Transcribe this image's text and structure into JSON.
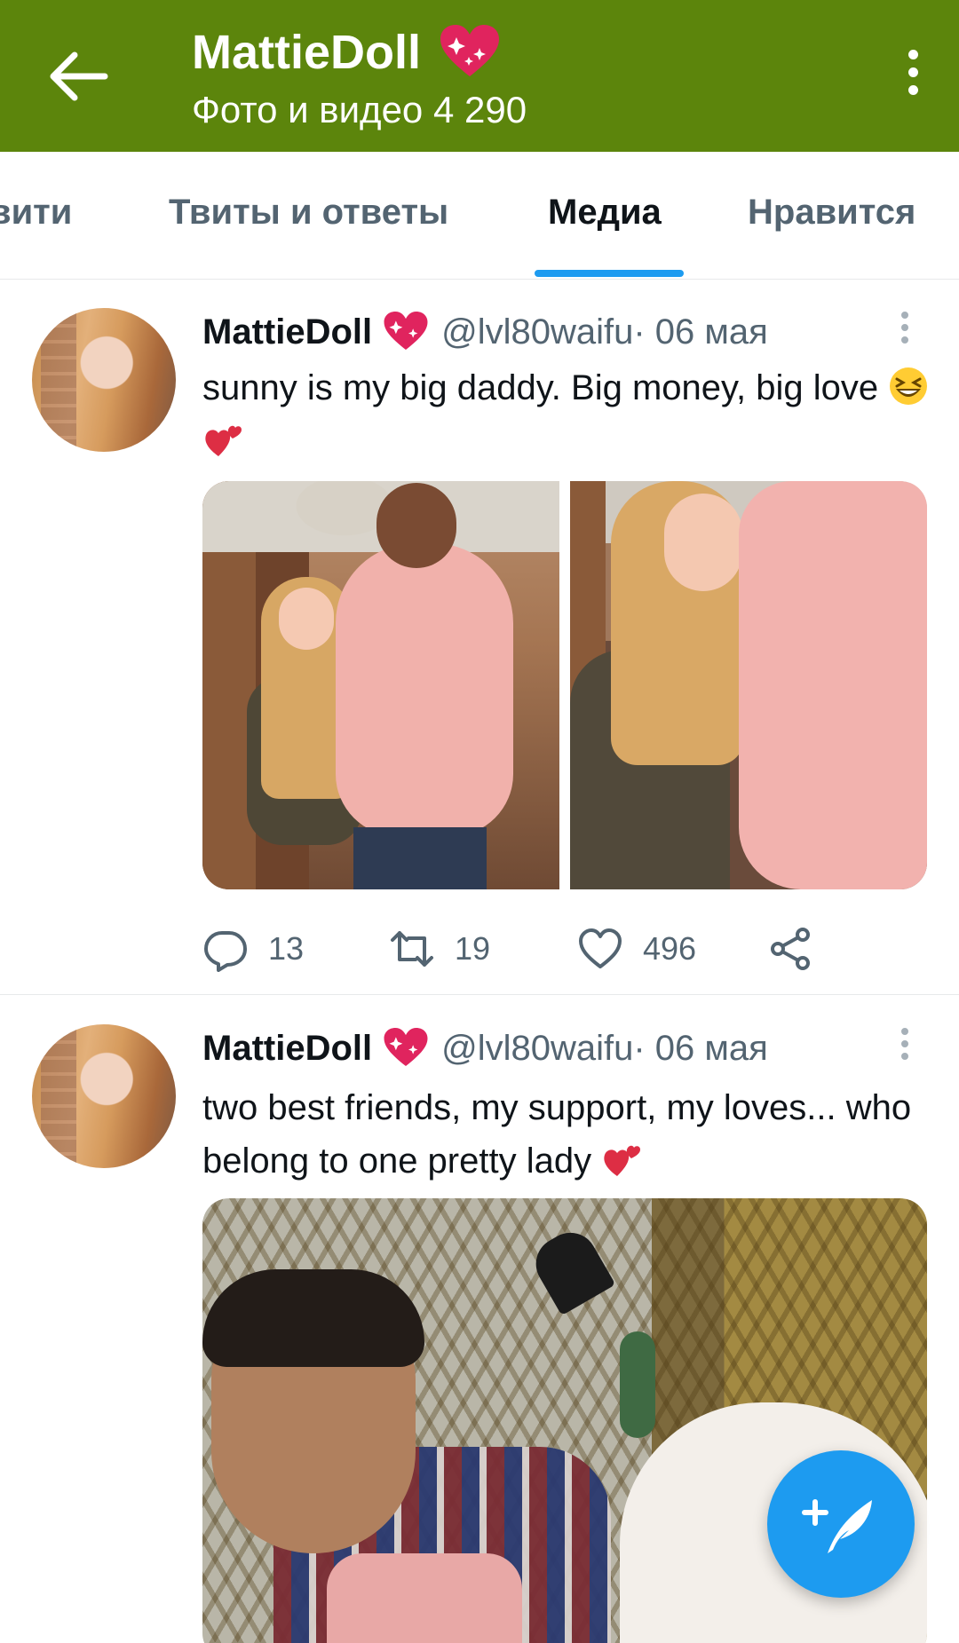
{
  "header": {
    "title": "MattieDoll",
    "subtitle": "Фото и видео 4 290",
    "back_icon": "arrow-left-icon",
    "more_icon": "more-vertical-icon",
    "background": "#5c850c"
  },
  "tabs": [
    {
      "label": "вити"
    },
    {
      "label": "Твиты и ответы"
    },
    {
      "label": "Медиа",
      "active": true
    },
    {
      "label": "Нравится"
    }
  ],
  "accent_color": "#1d9bf0",
  "tweets": [
    {
      "author": "MattieDoll",
      "handle": "@lvl80waifu",
      "date": " · 06 мая",
      "text": "sunny is my big daddy. Big money, big love",
      "emojis": [
        "laughing-face-emoji",
        "two-hearts-emoji"
      ],
      "media": [
        "photo",
        "photo"
      ],
      "replies": "13",
      "retweets": "19",
      "likes": "496"
    },
    {
      "author": "MattieDoll",
      "handle": "@lvl80waifu",
      "date": " · 06 мая",
      "text": "two best friends, my support, my loves... who belong to one pretty lady",
      "emojis": [
        "two-hearts-emoji"
      ],
      "media": [
        "photo"
      ]
    }
  ],
  "fab": {
    "icon": "compose-tweet-icon"
  }
}
